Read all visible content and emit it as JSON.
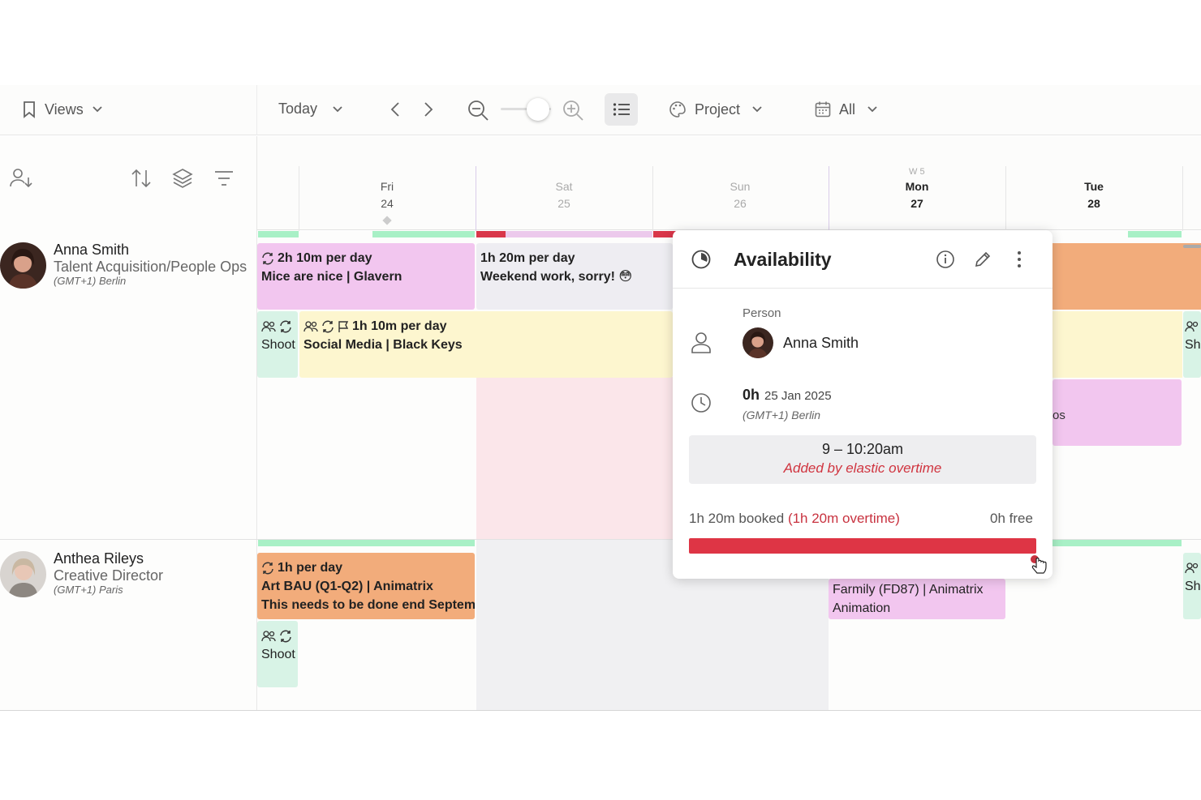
{
  "toolbar": {
    "views_label": "Views",
    "today_label": "Today",
    "project_label": "Project",
    "all_label": "All"
  },
  "days": [
    {
      "name": "Fri",
      "date": "24"
    },
    {
      "name": "Sat",
      "date": "25"
    },
    {
      "name": "Sun",
      "date": "26"
    },
    {
      "name": "Mon",
      "date": "27"
    },
    {
      "name": "Tue",
      "date": "28"
    }
  ],
  "week_label": "W 5",
  "people": [
    {
      "name": "Anna Smith",
      "role": "Talent Acquisition/People Ops",
      "tz": "(GMT+1) Berlin"
    },
    {
      "name": "Anthea Rileys",
      "role": "Creative Director",
      "tz": "(GMT+1) Paris"
    }
  ],
  "bookings": {
    "anna_fri": {
      "hours": "2h 10m per day",
      "project": "Mice are nice | Glavern"
    },
    "anna_sat": {
      "hours": "1h 20m per day",
      "project": "Weekend work, sorry! 😳"
    },
    "anna_shoot": {
      "project": "Shoot"
    },
    "anna_social": {
      "hours": "1h 10m per day",
      "project": "Social Media | Black Keys"
    },
    "anna_tue_partial": {
      "text": "os"
    },
    "anna_edge": {
      "text": "Sh"
    },
    "anthea_fri": {
      "hours": "1h per day",
      "project": "Art BAU (Q1-Q2) | Animatrix",
      "note": "This needs to be done end Septemb"
    },
    "anthea_shoot": {
      "project": "Shoot"
    },
    "anthea_mon": {
      "project": "Farmily (FD87) | Animatrix",
      "note": "Animation"
    },
    "anthea_edge": {
      "text": "Sh"
    }
  },
  "popover": {
    "title": "Availability",
    "person_label": "Person",
    "person_name": "Anna Smith",
    "hours": "0h",
    "date": "25 Jan 2025",
    "tz": "(GMT+1) Berlin",
    "time_range": "9 – 10:20am",
    "time_note": "Added by elastic overtime",
    "booked": "1h 20m booked",
    "overtime": "(1h 20m overtime)",
    "free": "0h free"
  },
  "colors": {
    "accent_red": "#de3545",
    "available_green": "#a8f0c6",
    "pink": "#f2c6ef",
    "yellow": "#fdf6cf",
    "orange": "#f2ac7b"
  }
}
